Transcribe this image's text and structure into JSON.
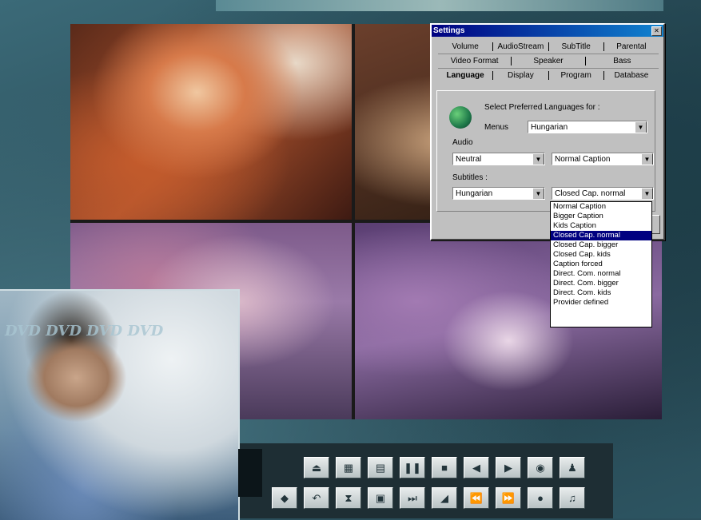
{
  "dialog": {
    "title": "Settings",
    "tabs_row1": [
      "Volume",
      "AudioStream",
      "SubTitle",
      "Parental"
    ],
    "tabs_row2": [
      "Video Format",
      "Speaker",
      "Bass"
    ],
    "tabs_row3": [
      "Language",
      "Display",
      "Program",
      "Database"
    ],
    "prompt": "Select Preferred Languages for :",
    "menus_label": "Menus",
    "menus_value": "Hungarian",
    "audio_label": "Audio",
    "audio_value": "Neutral",
    "audio_caption_value": "Normal Caption",
    "subtitles_label": "Subtitles :",
    "subtitles_value": "Hungarian",
    "subtitles_caption_value": "Closed Cap. normal"
  },
  "caption_dropdown": {
    "options": [
      "Normal Caption",
      "Bigger Caption",
      "Kids Caption",
      "Closed Cap. normal",
      "Closed Cap. bigger",
      "Closed Cap. kids",
      "Caption forced",
      "Direct. Com. normal",
      "Direct. Com. bigger",
      "Direct. Com. kids",
      "Provider defined"
    ],
    "selected_index": 3
  },
  "photo": {
    "watermark": "DVD DVD DVD DVD"
  },
  "controls": {
    "row1_icons": [
      "eject-icon",
      "grid-icon",
      "title-menu-icon",
      "chapter-icon",
      "stop-icon",
      "rewind-icon",
      "forward-icon",
      "camera-icon",
      "angle-icon"
    ],
    "row2_icons": [
      "previous-icon",
      "back-icon",
      "slow-icon",
      "play-icon",
      "skip-end-icon",
      "volume-icon",
      "fast-rewind-icon",
      "fast-forward-icon",
      "record-icon",
      "audio-icon"
    ]
  }
}
